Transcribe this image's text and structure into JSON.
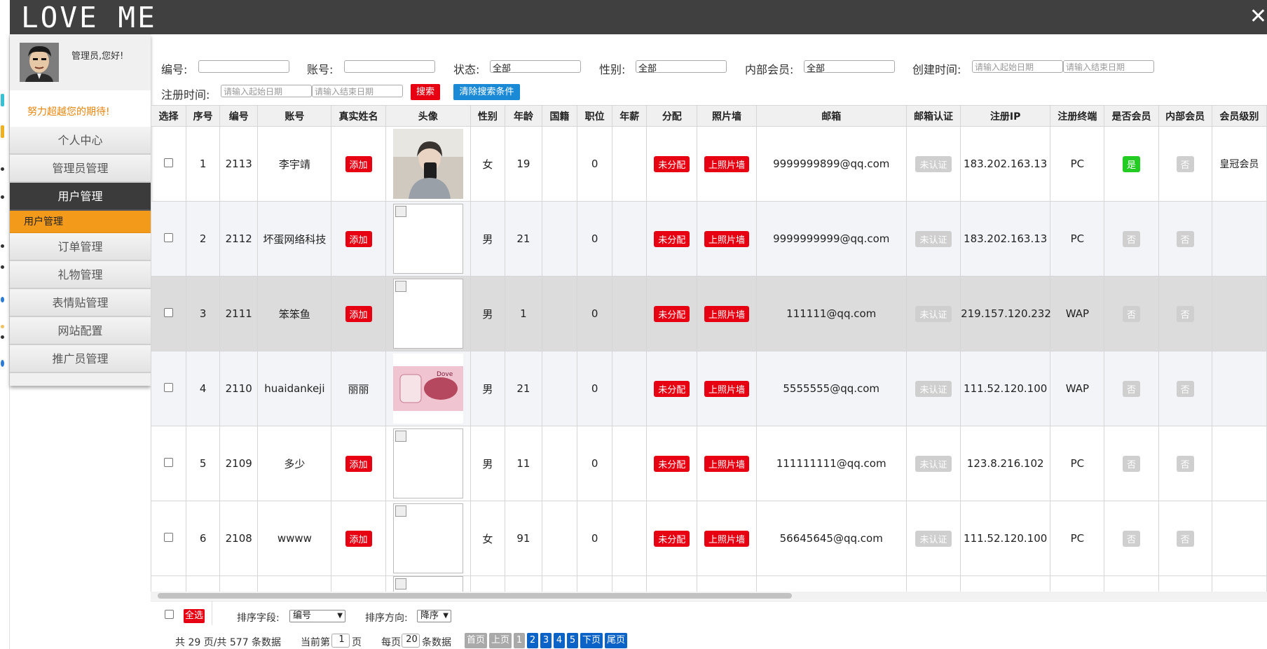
{
  "app": {
    "title": "LOVE ME",
    "close_label": "✕"
  },
  "sidebar": {
    "greeting": "管理员,您好!",
    "slogan": "努力超越您的期待!",
    "items": [
      {
        "label": "个人中心"
      },
      {
        "label": "管理员管理"
      },
      {
        "label": "用户管理"
      },
      {
        "label": "用户管理"
      },
      {
        "label": "订单管理"
      },
      {
        "label": "礼物管理"
      },
      {
        "label": "表情贴管理"
      },
      {
        "label": "网站配置"
      },
      {
        "label": "推广员管理"
      }
    ]
  },
  "search": {
    "id_label": "编号:",
    "id_value": "",
    "account_label": "账号:",
    "account_value": "",
    "status_label": "状态:",
    "status_value": "全部",
    "gender_label": "性别:",
    "gender_value": "全部",
    "internal_label": "内部会员:",
    "internal_value": "全部",
    "created_label": "创建时间:",
    "created_start_placeholder": "请输入起始日期",
    "created_end_placeholder": "请输入结束日期",
    "reg_label": "注册时间:",
    "reg_start_placeholder": "请输入起始日期",
    "reg_end_placeholder": "请输入结束日期",
    "search_button": "搜索",
    "clear_button": "清除搜索条件"
  },
  "table": {
    "headers": [
      "选择",
      "序号",
      "编号",
      "账号",
      "真实姓名",
      "头像",
      "性别",
      "年龄",
      "国籍",
      "职位",
      "年薪",
      "分配",
      "照片墙",
      "邮箱",
      "邮箱认证",
      "注册IP",
      "注册终端",
      "是否会员",
      "内部会员",
      "会员级别"
    ],
    "rows": [
      {
        "seq": "1",
        "id": "2113",
        "account": "李宇靖",
        "realname": "添加",
        "realname_is_button": true,
        "avatar": "photo",
        "gender": "女",
        "age": "19",
        "nationality": "",
        "position": "0",
        "salary": "",
        "assign": "未分配",
        "wall": "上照片墙",
        "email": "9999999899@qq.com",
        "email_verify": "未认证",
        "ip": "183.202.163.13",
        "terminal": "PC",
        "member": "是",
        "internal": "否",
        "level": "皇冠会员"
      },
      {
        "seq": "2",
        "id": "2112",
        "account": "坏蛋网络科技",
        "realname": "添加",
        "realname_is_button": true,
        "avatar": "broken",
        "gender": "男",
        "age": "21",
        "nationality": "",
        "position": "0",
        "salary": "",
        "assign": "未分配",
        "wall": "上照片墙",
        "email": "9999999999@qq.com",
        "email_verify": "未认证",
        "ip": "183.202.163.13",
        "terminal": "PC",
        "member": "否",
        "internal": "否",
        "level": ""
      },
      {
        "seq": "3",
        "id": "2111",
        "account": "笨笨鱼",
        "realname": "添加",
        "realname_is_button": true,
        "avatar": "broken",
        "gender": "男",
        "age": "1",
        "nationality": "",
        "position": "0",
        "salary": "",
        "assign": "未分配",
        "wall": "上照片墙",
        "email": "111111@qq.com",
        "email_verify": "未认证",
        "ip": "219.157.120.232",
        "terminal": "WAP",
        "member": "否",
        "internal": "否",
        "level": ""
      },
      {
        "seq": "4",
        "id": "2110",
        "account": "huaidankeji",
        "realname": "丽丽",
        "realname_is_button": false,
        "avatar": "gift",
        "gender": "男",
        "age": "21",
        "nationality": "",
        "position": "0",
        "salary": "",
        "assign": "未分配",
        "wall": "上照片墙",
        "email": "5555555@qq.com",
        "email_verify": "未认证",
        "ip": "111.52.120.100",
        "terminal": "WAP",
        "member": "否",
        "internal": "否",
        "level": ""
      },
      {
        "seq": "5",
        "id": "2109",
        "account": "多少",
        "realname": "添加",
        "realname_is_button": true,
        "avatar": "broken",
        "gender": "男",
        "age": "11",
        "nationality": "",
        "position": "0",
        "salary": "",
        "assign": "未分配",
        "wall": "上照片墙",
        "email": "111111111@qq.com",
        "email_verify": "未认证",
        "ip": "123.8.216.102",
        "terminal": "PC",
        "member": "否",
        "internal": "否",
        "level": ""
      },
      {
        "seq": "6",
        "id": "2108",
        "account": "wwww",
        "realname": "添加",
        "realname_is_button": true,
        "avatar": "broken",
        "gender": "女",
        "age": "91",
        "nationality": "",
        "position": "0",
        "salary": "",
        "assign": "未分配",
        "wall": "上照片墙",
        "email": "56645645@qq.com",
        "email_verify": "未认证",
        "ip": "111.52.120.100",
        "terminal": "PC",
        "member": "否",
        "internal": "否",
        "level": ""
      }
    ]
  },
  "bottom": {
    "select_all": "全选",
    "sort_field_label": "排序字段:",
    "sort_field_value": "编号",
    "sort_dir_label": "排序方向:",
    "sort_dir_value": "降序",
    "summary": "共 29 页/共 577 条数据",
    "current_prefix": "当前第",
    "current_value": "1",
    "current_suffix": "页",
    "per_prefix": "每页",
    "per_value": "20",
    "per_suffix": "条数据",
    "pager": [
      "首页",
      "上页",
      "1",
      "2",
      "3",
      "4",
      "5",
      "下页",
      "尾页"
    ]
  },
  "colors": {
    "topbar": "#404040",
    "accent_orange": "#f39a1b",
    "red": "#e60012",
    "blue": "#1a8ad6",
    "green": "#22cc22"
  }
}
